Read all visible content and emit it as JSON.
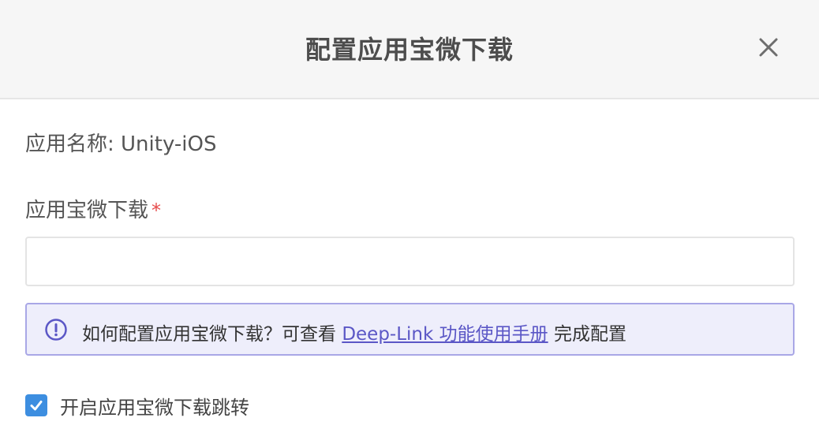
{
  "dialog": {
    "title": "配置应用宝微下载",
    "close_icon": "close-icon"
  },
  "app": {
    "name_label": "应用名称: Unity-iOS"
  },
  "field": {
    "label": "应用宝微下载",
    "required_mark": "*",
    "value": "",
    "placeholder": ""
  },
  "info": {
    "icon": "info-circle-icon",
    "text_before": "如何配置应用宝微下载？可查看 ",
    "link_text": "Deep-Link 功能使用手册",
    "text_after": " 完成配置",
    "accent_color": "#5b57c6",
    "background_color": "#eeeefb"
  },
  "option": {
    "checked": true,
    "label": "开启应用宝微下载跳转",
    "checkbox_color": "#3d8ee0"
  }
}
